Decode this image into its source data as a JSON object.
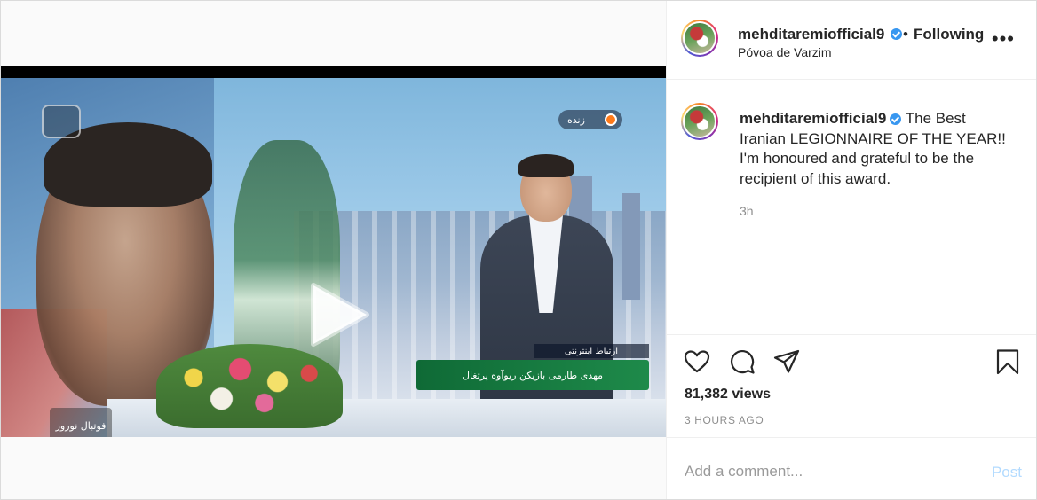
{
  "header": {
    "username": "mehditaremiofficial9",
    "separator": "•",
    "follow_label": "Following",
    "location": "Póvoa de Varzim",
    "more_label": "•••"
  },
  "caption": {
    "username": "mehditaremiofficial9",
    "text": "The Best Iranian LEGIONNAIRE OF THE YEAR!! I'm honoured and grateful to be the recipient of this award.",
    "time": "3h"
  },
  "video": {
    "live_label": "زنده",
    "lower_third_top": "ارتباط اینترنتی",
    "lower_third": "مهدی طارمی   بازیکن ریوآوه پرتغال",
    "show_logo": "فوتبال نوروز"
  },
  "actions": {
    "views": "81,382 views",
    "time_ago": "3 HOURS AGO"
  },
  "comment": {
    "placeholder": "Add a comment...",
    "post_label": "Post"
  },
  "colors": {
    "verified": "#3897f0",
    "post_disabled": "#b3dbff",
    "secondary_text": "#8e8e8e",
    "border": "#efefef"
  },
  "icons": [
    "play-icon",
    "heart-icon",
    "comment-icon",
    "share-icon",
    "bookmark-icon",
    "verified-badge-icon",
    "more-icon"
  ]
}
